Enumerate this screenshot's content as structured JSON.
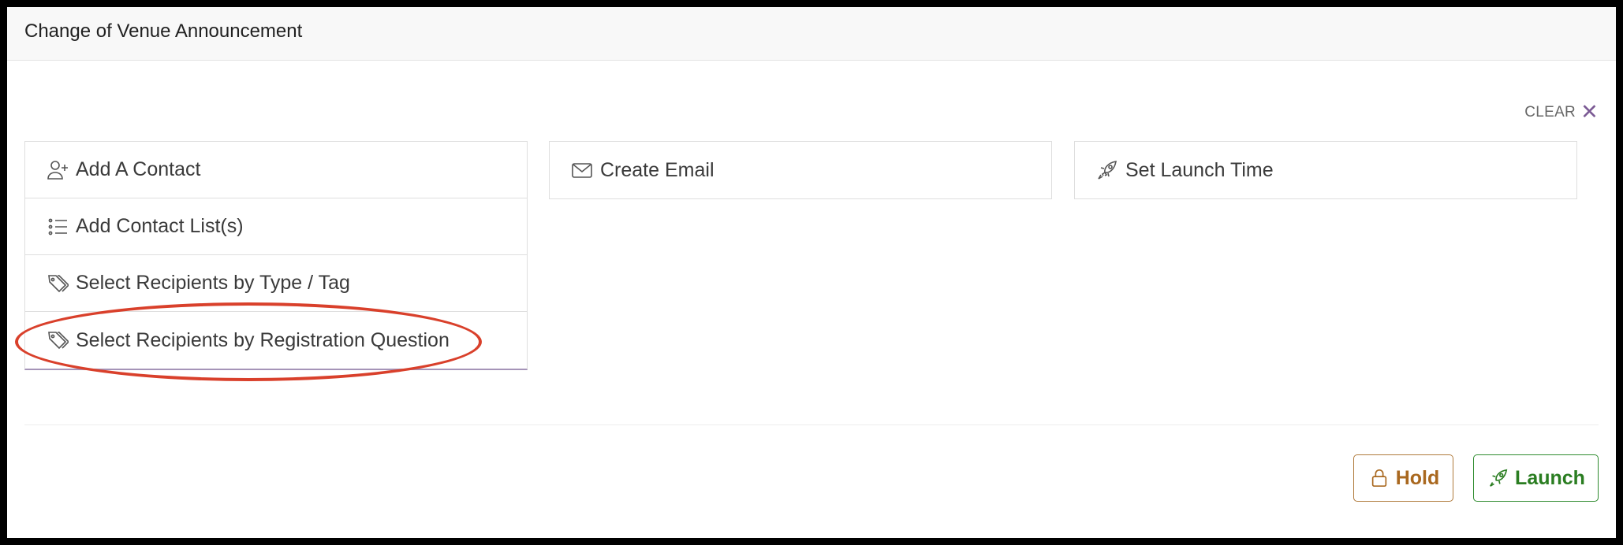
{
  "header": {
    "title": "Change of Venue Announcement"
  },
  "clear": {
    "label": "CLEAR",
    "icon": "close-icon"
  },
  "recipients": {
    "items": [
      {
        "label": "Add A Contact",
        "icon": "add-user-icon"
      },
      {
        "label": "Add Contact List(s)",
        "icon": "list-icon"
      },
      {
        "label": "Select Recipients by Type / Tag",
        "icon": "tag-icon"
      },
      {
        "label": "Select Recipients by Registration Question",
        "icon": "tag-icon"
      }
    ]
  },
  "email": {
    "label": "Create Email",
    "icon": "envelope-icon"
  },
  "launch_time": {
    "label": "Set Launch Time",
    "icon": "rocket-icon"
  },
  "actions": {
    "hold_label": "Hold",
    "hold_icon": "lock-icon",
    "launch_label": "Launch",
    "launch_icon": "rocket-icon"
  },
  "colors": {
    "accent": "#7b5a94",
    "hold": "#a9681f",
    "launch": "#2a7d21",
    "annotation": "#d9402b"
  }
}
